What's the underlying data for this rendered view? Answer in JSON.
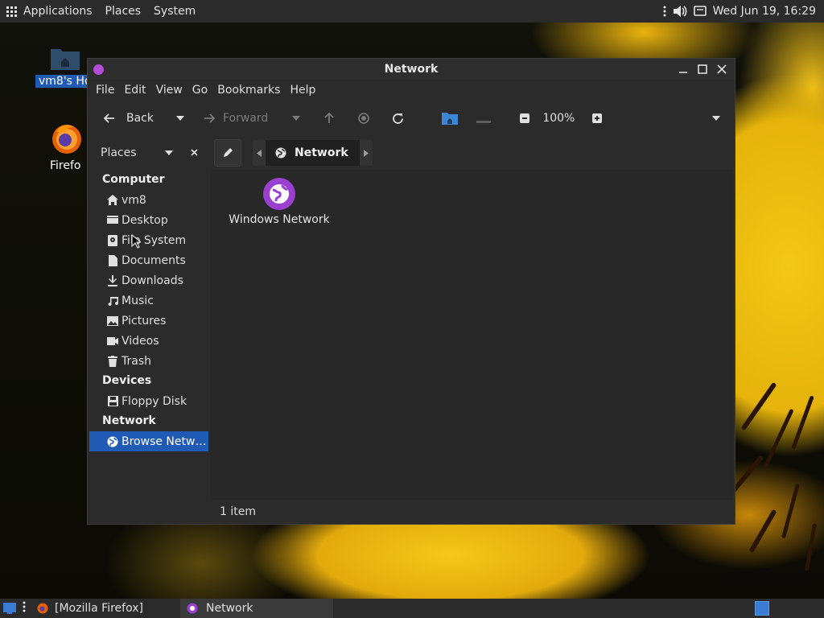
{
  "top_panel": {
    "menus": [
      "Applications",
      "Places",
      "System"
    ],
    "clock": "Wed Jun 19, 16:29"
  },
  "desktop": {
    "home_label": "vm8's Ho",
    "firefox_label": "Firefo"
  },
  "window": {
    "title": "Network",
    "menu": [
      "File",
      "Edit",
      "View",
      "Go",
      "Bookmarks",
      "Help"
    ],
    "toolbar": {
      "back": "Back",
      "forward": "Forward",
      "zoom": "100%"
    },
    "location": {
      "places_label": "Places",
      "path_segment": "Network"
    },
    "sidebar": {
      "computer_heading": "Computer",
      "computer_items": [
        "vm8",
        "Desktop",
        "File System",
        "Documents",
        "Downloads",
        "Music",
        "Pictures",
        "Videos",
        "Trash"
      ],
      "devices_heading": "Devices",
      "device_items": [
        "Floppy Disk"
      ],
      "network_heading": "Network",
      "network_items": [
        "Browse Netw…"
      ]
    },
    "files": [
      {
        "name": "Windows Network",
        "icon": "globe-icon"
      }
    ],
    "status": "1 item"
  },
  "taskbar": {
    "tasks": [
      "[Mozilla Firefox]",
      "Network"
    ]
  },
  "colors": {
    "accent": "#1f5bb5",
    "network_icon": "#9b3fd0",
    "panel": "#2b2b2b"
  }
}
